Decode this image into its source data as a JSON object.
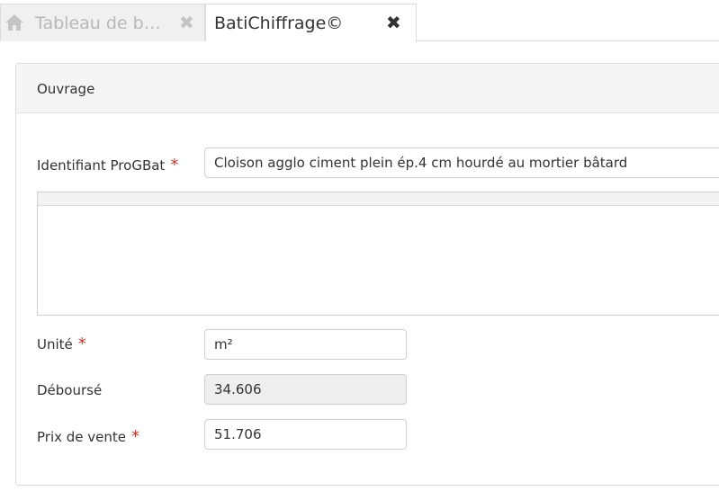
{
  "tabs": [
    {
      "label": "Tableau de b…",
      "icon": "home-icon",
      "close": "✖"
    },
    {
      "label": "BatiChiffrage©",
      "close": "✖"
    }
  ],
  "panel": {
    "title": "Ouvrage"
  },
  "form": {
    "identifiant": {
      "label": "Identifiant ProGBat",
      "required": "*",
      "value": "Cloison agglo ciment plein ép.4 cm hourdé au mortier bâtard"
    },
    "description": {
      "value": ""
    },
    "unite": {
      "label": "Unité",
      "required": "*",
      "value": "m²"
    },
    "debourse": {
      "label": "Déboursé",
      "value": "34.606"
    },
    "prix": {
      "label": "Prix de vente",
      "required": "*",
      "value": "51.706"
    }
  },
  "colors": {
    "required": "#c0392b",
    "border": "#cfcfcf",
    "header_bg": "#f5f5f5"
  }
}
